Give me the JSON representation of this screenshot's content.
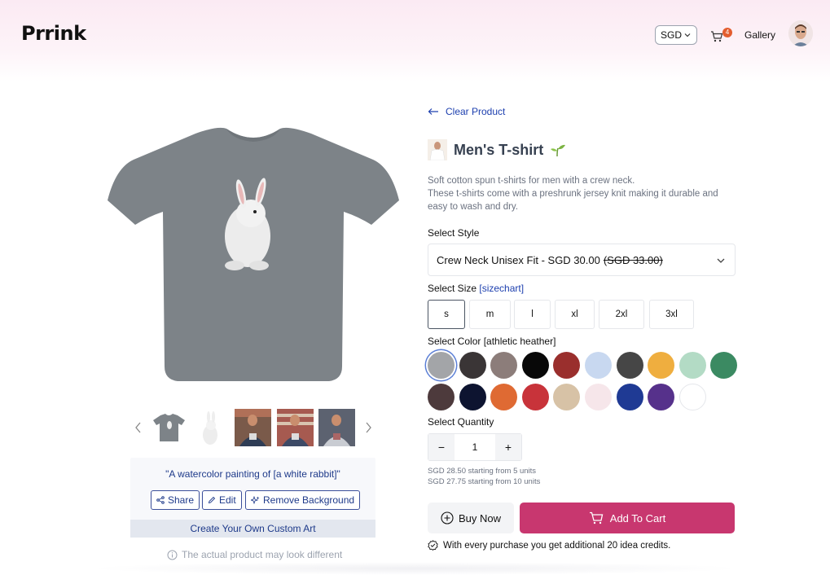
{
  "header": {
    "logo": "Prrink",
    "currency": "SGD",
    "cart_count": "4",
    "gallery_label": "Gallery"
  },
  "product": {
    "back_label": "Clear Product",
    "title": "Men's T-shirt",
    "description_line1": "Soft cotton spun t-shirts for men with a crew neck.",
    "description_line2": "These t-shirts come with a preshrunk jersey knit making it durable and easy to wash and dry.",
    "style_label": "Select Style",
    "style_value": "Crew Neck Unisex Fit - SGD 30.00",
    "style_original_price": "(SGD 33.00)",
    "size_label": "Select Size",
    "sizechart_label": "[sizechart]",
    "sizes": [
      "s",
      "m",
      "l",
      "xl",
      "2xl",
      "3xl"
    ],
    "selected_size": "s",
    "color_label": "Select Color [athletic heather]",
    "colors": [
      "#a3a5a8",
      "#3a3536",
      "#8c7d7a",
      "#080808",
      "#9a2f2d",
      "#c8d8f0",
      "#464646",
      "#efae3f",
      "#b3dbc5",
      "#3b8a62",
      "#4d3a3c",
      "#0d1430",
      "#df6a33",
      "#c8333a",
      "#d7c2a6",
      "#f6e6ea",
      "#1f3a94",
      "#56318b",
      "#ffffff"
    ],
    "selected_color": "athletic heather",
    "quantity_label": "Select Quantity",
    "quantity": "1",
    "tier1": "SGD 28.50 starting from 5 units",
    "tier2": "SGD 27.75 starting from 10 units",
    "buy_now": "Buy Now",
    "add_to_cart": "Add To Cart",
    "credits_note": "With every purchase you get additional 20 idea credits."
  },
  "preview": {
    "prompt": "\"A watercolor painting of [a white rabbit]\"",
    "share": "Share",
    "edit": "Edit",
    "remove_bg": "Remove Background",
    "create_art": "Create Your Own Custom Art",
    "disclaimer": "The actual product may look different"
  },
  "colors": {
    "accent": "#c8376f",
    "link": "#1e40af",
    "shirt": "#7d8388"
  }
}
